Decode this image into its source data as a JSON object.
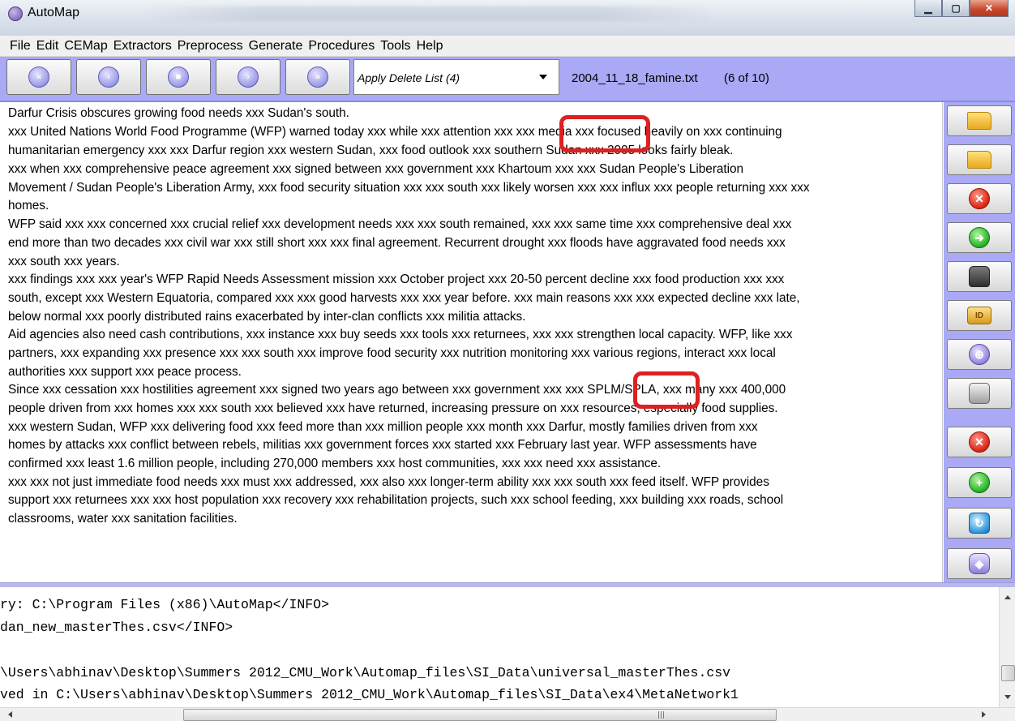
{
  "window": {
    "title": "AutoMap"
  },
  "menu": [
    "File",
    "Edit",
    "CEMap",
    "Extractors",
    "Preprocess",
    "Generate",
    "Procedures",
    "Tools",
    "Help"
  ],
  "toolbar": {
    "nav_buttons": [
      {
        "name": "first-document-button",
        "icon": "double-left-arrow-icon",
        "glyph": "«"
      },
      {
        "name": "previous-document-button",
        "icon": "left-arrow-icon",
        "glyph": "‹"
      },
      {
        "name": "stop-button",
        "icon": "stop-icon",
        "glyph": "■"
      },
      {
        "name": "next-document-button",
        "icon": "right-arrow-icon",
        "glyph": "›"
      },
      {
        "name": "last-document-button",
        "icon": "double-right-arrow-icon",
        "glyph": "»"
      }
    ],
    "procedure_select": "Apply Delete List (4)",
    "file_name": "2004_11_18_famine.txt",
    "file_position": "(6 of 10)"
  },
  "document": {
    "lines": [
      "Darfur Crisis obscures growing food needs xxx Sudan's south.",
      "xxx United Nations World Food Programme (WFP) warned today xxx while xxx attention xxx xxx media xxx focused heavily on xxx continuing",
      "humanitarian emergency xxx xxx Darfur region xxx western Sudan, xxx food outlook xxx southern Sudan xxx 2005 looks fairly bleak.",
      "xxx when xxx comprehensive peace agreement xxx signed between xxx government xxx Khartoum xxx xxx Sudan People's Liberation",
      "Movement / Sudan People's Liberation Army, xxx food security situation xxx xxx south xxx likely worsen xxx xxx influx xxx people returning xxx xxx",
      "homes.",
      "WFP said xxx xxx concerned xxx crucial relief xxx development needs xxx xxx south remained, xxx xxx same time xxx comprehensive deal xxx",
      "end more than two decades xxx civil war xxx still short xxx xxx final agreement. Recurrent drought xxx floods have aggravated food needs xxx",
      "xxx south xxx years.",
      "xxx findings xxx xxx year's WFP Rapid Needs Assessment mission xxx October project xxx 20-50 percent decline xxx food production xxx xxx",
      "south, except xxx Western Equatoria, compared xxx xxx good harvests xxx xxx year before. xxx main reasons xxx xxx expected decline xxx late,",
      "below normal xxx poorly distributed rains exacerbated by inter-clan conflicts xxx militia attacks.",
      "Aid agencies also need cash contributions, xxx instance xxx buy seeds xxx tools xxx returnees, xxx xxx strengthen local capacity. WFP, like xxx",
      "partners, xxx expanding xxx presence xxx xxx south xxx improve food security xxx nutrition monitoring xxx various regions, interact xxx local",
      "authorities xxx support xxx peace process.",
      "Since xxx cessation xxx hostilities agreement xxx signed two years ago between xxx government xxx xxx SPLM/SPLA, xxx many xxx 400,000",
      "people driven from xxx homes xxx xxx south xxx believed xxx have returned, increasing pressure on xxx resources, especially food supplies.",
      "xxx western Sudan, WFP xxx delivering food xxx feed more than xxx million people xxx month xxx Darfur, mostly families driven from xxx",
      "homes by attacks xxx conflict between rebels, militias xxx government forces xxx started xxx February last year. WFP assessments have",
      "confirmed xxx least 1.6 million people, including 270,000 members xxx host communities, xxx xxx need xxx assistance.",
      "xxx xxx not just immediate food needs xxx must xxx addressed, xxx also xxx longer-term ability xxx xxx south xxx feed itself. WFP provides",
      "support xxx returnees xxx xxx host population xxx recovery xxx rehabilitation projects, such xxx school feeding, xxx building xxx roads, school",
      "classrooms, water xxx sanitation facilities."
    ]
  },
  "side_tools": [
    {
      "name": "open-folder-button",
      "icon": "folder-open-icon",
      "style": "folder",
      "glyph": ""
    },
    {
      "name": "open-project-button",
      "icon": "folder-search-icon",
      "style": "folder",
      "glyph": ""
    },
    {
      "name": "delete-button",
      "icon": "red-x-icon",
      "style": "red",
      "glyph": "✕"
    },
    {
      "name": "forward-button",
      "icon": "green-arrow-icon",
      "style": "green",
      "glyph": "➜"
    },
    {
      "name": "lock-button",
      "icon": "lock-icon",
      "style": "lock",
      "glyph": ""
    },
    {
      "name": "id-button",
      "icon": "id-badge-icon",
      "style": "amber",
      "glyph": "ID"
    },
    {
      "name": "network-button",
      "icon": "globe-network-icon",
      "style": "purple",
      "glyph": "⊕"
    },
    {
      "name": "database-button",
      "icon": "database-icon",
      "style": "gray",
      "glyph": ""
    },
    {
      "name": "delete-edit-button",
      "icon": "red-x-edit-icon",
      "style": "red",
      "glyph": "✕"
    },
    {
      "name": "add-edit-button",
      "icon": "green-edit-icon",
      "style": "green",
      "glyph": "+"
    },
    {
      "name": "refresh-button",
      "icon": "blue-refresh-icon",
      "style": "blue",
      "glyph": "↻"
    },
    {
      "name": "network-graph-button",
      "icon": "network-graph-icon",
      "style": "netpurple",
      "glyph": "◈"
    }
  ],
  "log": {
    "lines": [
      "ry: C:\\Program Files (x86)\\AutoMap</INFO>",
      "dan_new_masterThes.csv</INFO>",
      "",
      "\\Users\\abhinav\\Desktop\\Summers 2012_CMU_Work\\Automap_files\\SI_Data\\universal_masterThes.csv",
      "ved in C:\\Users\\abhinav\\Desktop\\Summers 2012_CMU_Work\\Automap_files\\SI_Data\\ex4\\MetaNetwork1"
    ]
  },
  "colors": {
    "toolbar_bg": "#a9a9f5",
    "highlight": "#e02020"
  }
}
